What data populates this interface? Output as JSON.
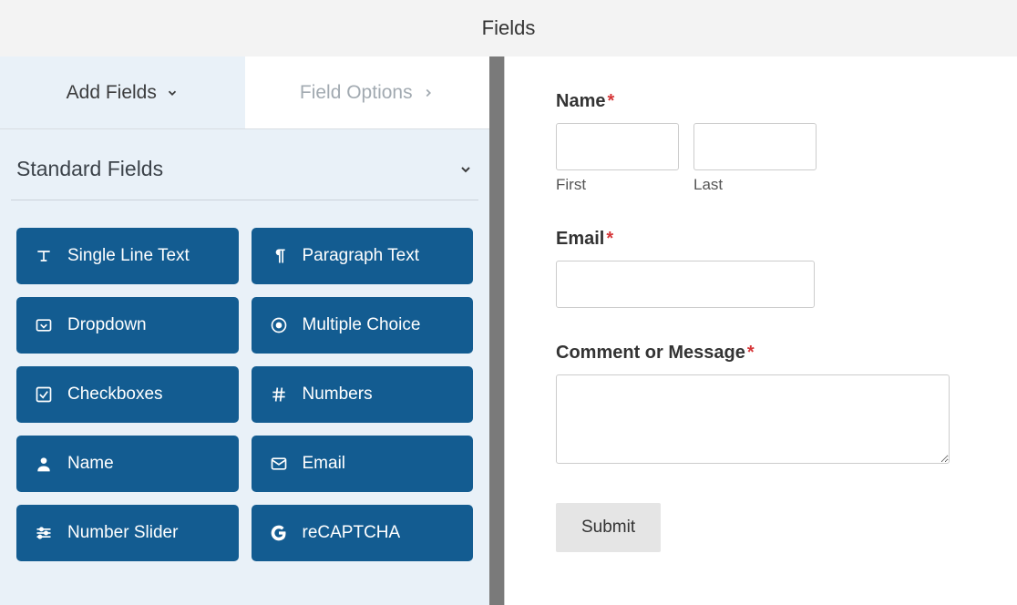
{
  "header": {
    "title": "Fields"
  },
  "tabs": {
    "add_fields": "Add Fields",
    "field_options": "Field Options"
  },
  "section": {
    "title": "Standard Fields"
  },
  "fields": {
    "single_line": "Single Line Text",
    "paragraph": "Paragraph Text",
    "dropdown": "Dropdown",
    "multiple_choice": "Multiple Choice",
    "checkboxes": "Checkboxes",
    "numbers": "Numbers",
    "name": "Name",
    "email": "Email",
    "number_slider": "Number Slider",
    "recaptcha": "reCAPTCHA"
  },
  "form": {
    "name_label": "Name",
    "first_sublabel": "First",
    "last_sublabel": "Last",
    "email_label": "Email",
    "message_label": "Comment or Message",
    "submit_label": "Submit",
    "required_mark": "*"
  }
}
